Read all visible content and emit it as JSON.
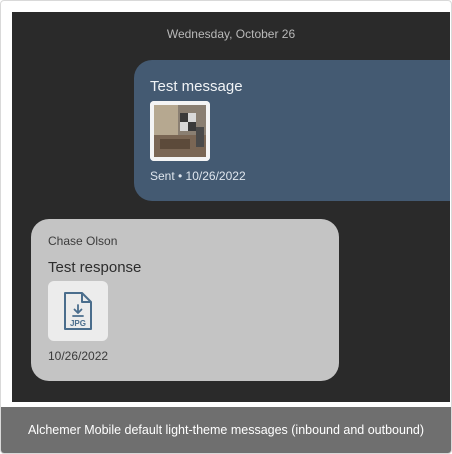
{
  "conversation": {
    "date_header": "Wednesday, October 26",
    "outbound": {
      "message": "Test message",
      "attachment_icon": "image-thumbnail",
      "status": "Sent • 10/26/2022"
    },
    "inbound": {
      "sender": "Chase Olson",
      "message": "Test response",
      "attachment_icon": "jpg-file-download-icon",
      "attachment_type": "JPG",
      "timestamp": "10/26/2022"
    }
  },
  "caption": "Alchemer Mobile default light-theme messages (inbound and outbound)",
  "colors": {
    "background": "#2a2a2a",
    "outbound_bubble": "#445a72",
    "inbound_bubble": "#c4c4c4",
    "caption_bar": "#6f6f6f"
  }
}
